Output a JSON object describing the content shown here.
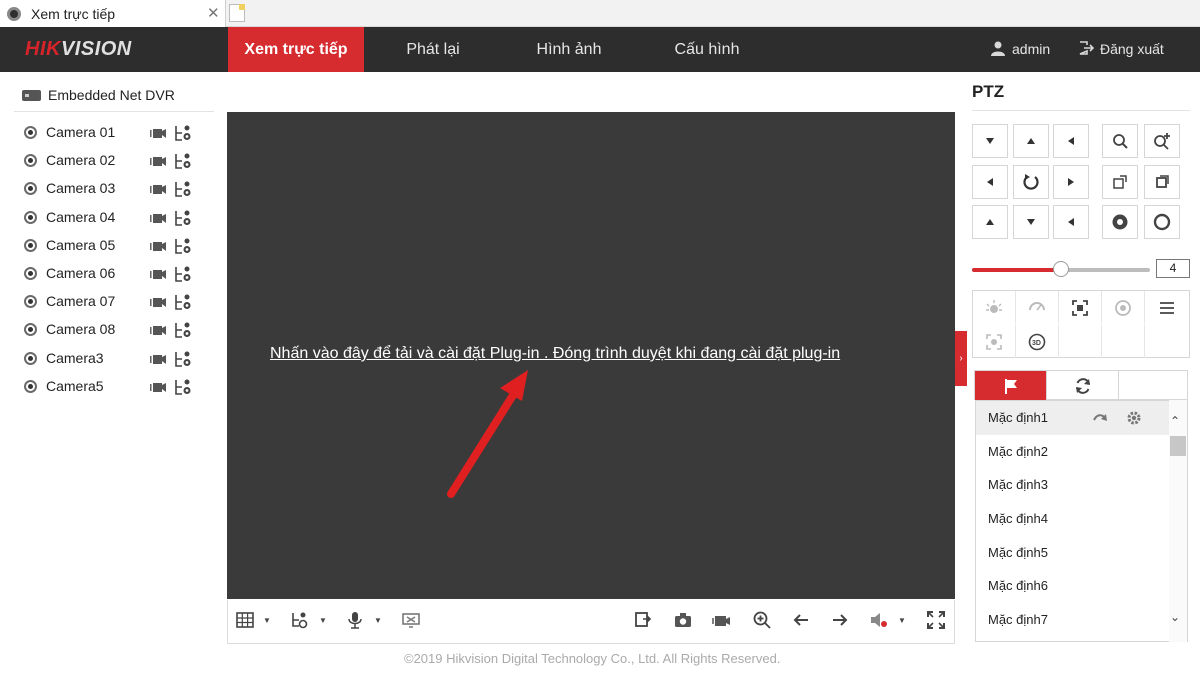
{
  "browser": {
    "tab_title": "Xem trực tiếp",
    "tab_close": "✕"
  },
  "header": {
    "logo_hik": "HIK",
    "logo_vision": "VISION",
    "nav": [
      {
        "label": "Xem trực tiếp",
        "active": true
      },
      {
        "label": "Phát lại",
        "active": false
      },
      {
        "label": "Hình ảnh",
        "active": false
      },
      {
        "label": "Cấu hình",
        "active": false
      }
    ],
    "user": "admin",
    "logout": "Đăng xuất",
    "accent_color": "#d62b2f",
    "bar_color": "#2d2d2d"
  },
  "device": {
    "name": "Embedded Net DVR",
    "cameras": [
      "Camera 01",
      "Camera 02",
      "Camera 03",
      "Camera 04",
      "Camera 05",
      "Camera 06",
      "Camera 07",
      "Camera 08",
      "Camera3",
      "Camera5"
    ]
  },
  "video": {
    "plugin_message": "Nhấn vào đây để tải và cài đặt Plug-in . Đóng trình duyệt khi đang cài đặt plug-in",
    "annotation_color": "#e02020"
  },
  "toolbar": {
    "left_icons": [
      "layout-grid-icon",
      "stream-type-icon",
      "microphone-icon",
      "display-icon"
    ],
    "right_icons": [
      "capture-all-icon",
      "camera-snapshot-icon",
      "record-icon",
      "digital-zoom-icon",
      "previous-page-icon",
      "next-page-icon",
      "audio-volume-icon",
      "fullscreen-icon"
    ]
  },
  "footer": {
    "copyright": "©2019 Hikvision Digital Technology Co., Ltd. All Rights Reserved."
  },
  "ptz": {
    "title": "PTZ",
    "speed_value": "4",
    "speed_level": 0.5,
    "presets": [
      "Mặc định1",
      "Mặc định2",
      "Mặc định3",
      "Mặc định4",
      "Mặc định5",
      "Mặc định6",
      "Mặc định7"
    ]
  }
}
